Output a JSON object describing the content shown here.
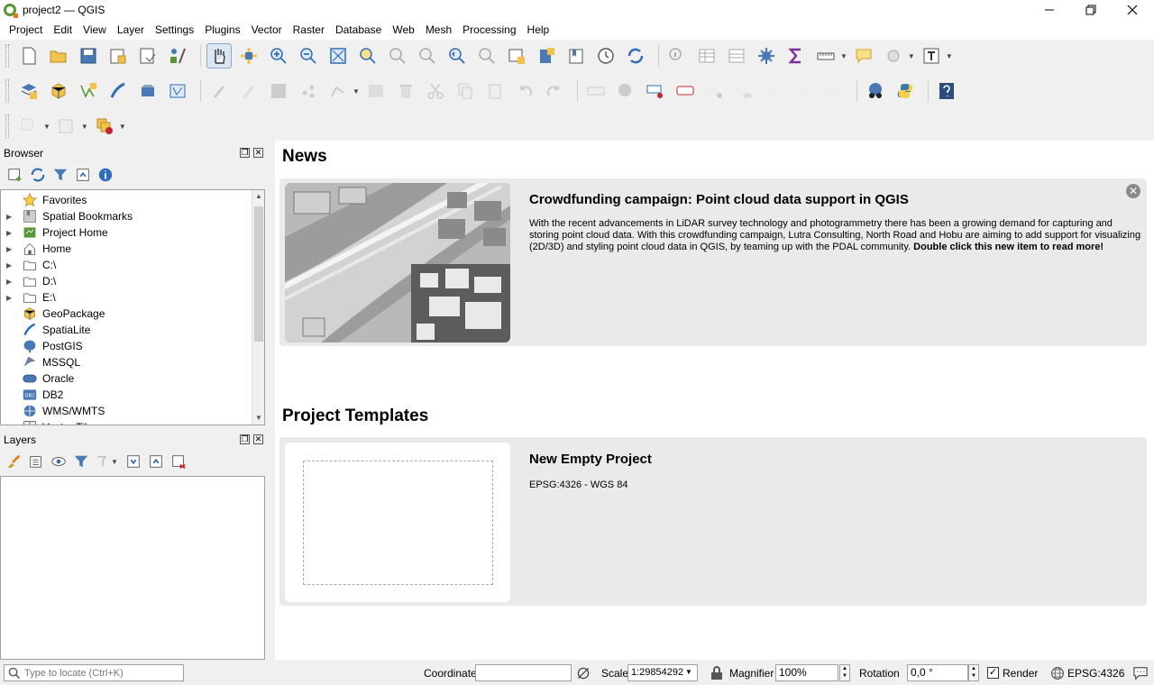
{
  "window": {
    "title": "project2 — QGIS",
    "minimize": "—",
    "restore": "❐",
    "close": "✕"
  },
  "menus": [
    "Project",
    "Edit",
    "View",
    "Layer",
    "Settings",
    "Plugins",
    "Vector",
    "Raster",
    "Database",
    "Web",
    "Mesh",
    "Processing",
    "Help"
  ],
  "panels": {
    "browser": {
      "title": "Browser"
    },
    "layers": {
      "title": "Layers"
    }
  },
  "browser_items": [
    {
      "label": "Favorites",
      "icon": "star-icon",
      "expandable": false
    },
    {
      "label": "Spatial Bookmarks",
      "icon": "bookmarks-icon",
      "expandable": true
    },
    {
      "label": "Project Home",
      "icon": "project-home-icon",
      "expandable": true
    },
    {
      "label": "Home",
      "icon": "home-icon",
      "expandable": true
    },
    {
      "label": "C:\\",
      "icon": "drive-icon",
      "expandable": true
    },
    {
      "label": "D:\\",
      "icon": "drive-icon",
      "expandable": true
    },
    {
      "label": "E:\\",
      "icon": "drive-icon",
      "expandable": true
    },
    {
      "label": "GeoPackage",
      "icon": "geopackage-icon",
      "expandable": false
    },
    {
      "label": "SpatiaLite",
      "icon": "spatialite-icon",
      "expandable": false
    },
    {
      "label": "PostGIS",
      "icon": "postgis-icon",
      "expandable": false
    },
    {
      "label": "MSSQL",
      "icon": "mssql-icon",
      "expandable": false
    },
    {
      "label": "Oracle",
      "icon": "oracle-icon",
      "expandable": false
    },
    {
      "label": "DB2",
      "icon": "db2-icon",
      "expandable": false
    },
    {
      "label": "WMS/WMTS",
      "icon": "wms-icon",
      "expandable": false
    },
    {
      "label": "Vector Tiles",
      "icon": "vector-tiles-icon",
      "expandable": false
    }
  ],
  "main": {
    "news_title": "News",
    "news": {
      "headline": "Crowdfunding campaign: Point cloud data support in QGIS",
      "body": "With the recent advancements in LiDAR survey technology and photogrammetry there has been a growing demand for capturing and storing point cloud data. With this crowdfunding campaign, Lutra Consulting, North Road and Hobu are aiming to add support for visualizing (2D/3D) and styling point cloud data in QGIS, by teaming up with the PDAL community. ",
      "cta": "Double click this new item to read more!"
    },
    "templates_title": "Project Templates",
    "template": {
      "title": "New Empty Project",
      "crs": "EPSG:4326 - WGS 84"
    }
  },
  "status": {
    "locator_placeholder": "Type to locate (Ctrl+K)",
    "coordinate_label": "Coordinate",
    "coordinate_value": "",
    "scale_label": "Scale",
    "scale_value": "1:29854292",
    "magnifier_label": "Magnifier",
    "magnifier_value": "100%",
    "rotation_label": "Rotation",
    "rotation_value": "0,0 °",
    "render_label": "Render",
    "render_checked": true,
    "crs": "EPSG:4326"
  },
  "colors": {
    "accent": "#589632",
    "qgis_orange": "#ee7913",
    "toolbar_blue": "#2f6db5"
  }
}
